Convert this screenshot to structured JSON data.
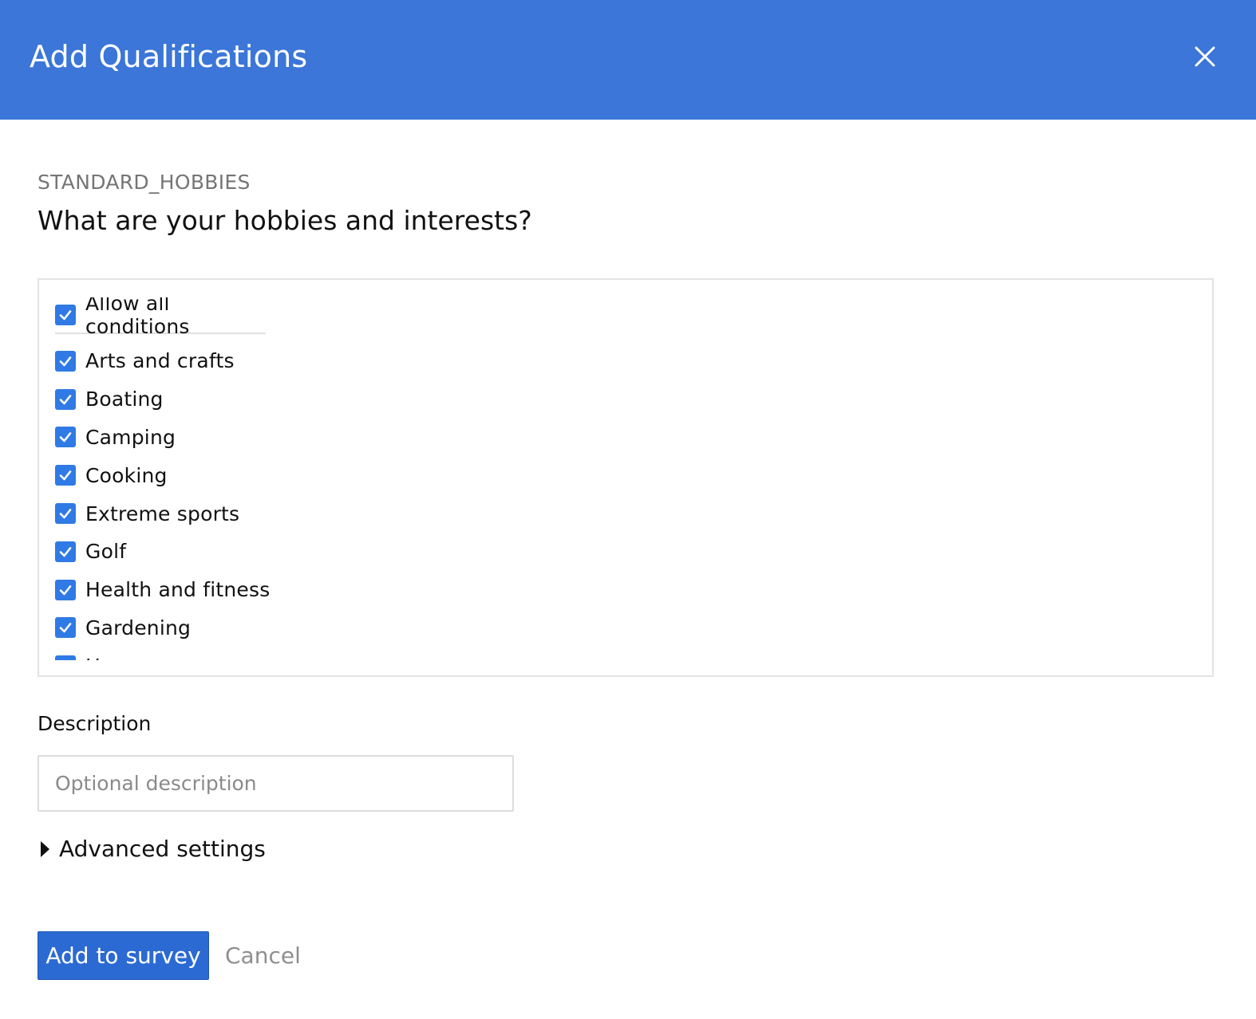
{
  "dialog": {
    "title": "Add Qualifications",
    "close_icon": "close-icon"
  },
  "question": {
    "key": "STANDARD_HOBBIES",
    "text": "What are your hobbies and interests?"
  },
  "conditions": {
    "allow_all": {
      "label": "Allow all conditions",
      "checked": true
    },
    "items": [
      {
        "label": "Arts and crafts",
        "checked": true
      },
      {
        "label": "Boating",
        "checked": true
      },
      {
        "label": "Camping",
        "checked": true
      },
      {
        "label": "Cooking",
        "checked": true
      },
      {
        "label": "Extreme sports",
        "checked": true
      },
      {
        "label": "Golf",
        "checked": true
      },
      {
        "label": "Health and fitness",
        "checked": true
      },
      {
        "label": "Gardening",
        "checked": true
      },
      {
        "label": "Horses",
        "checked": true
      }
    ]
  },
  "description": {
    "label": "Description",
    "placeholder": "Optional description",
    "value": ""
  },
  "advanced": {
    "label": "Advanced settings",
    "icon": "caret-right-icon"
  },
  "actions": {
    "submit_label": "Add to survey",
    "cancel_label": "Cancel"
  },
  "colors": {
    "header": "#3b76d8",
    "checkbox": "#2f7ae5",
    "primary_button": "#2c6ad3"
  }
}
